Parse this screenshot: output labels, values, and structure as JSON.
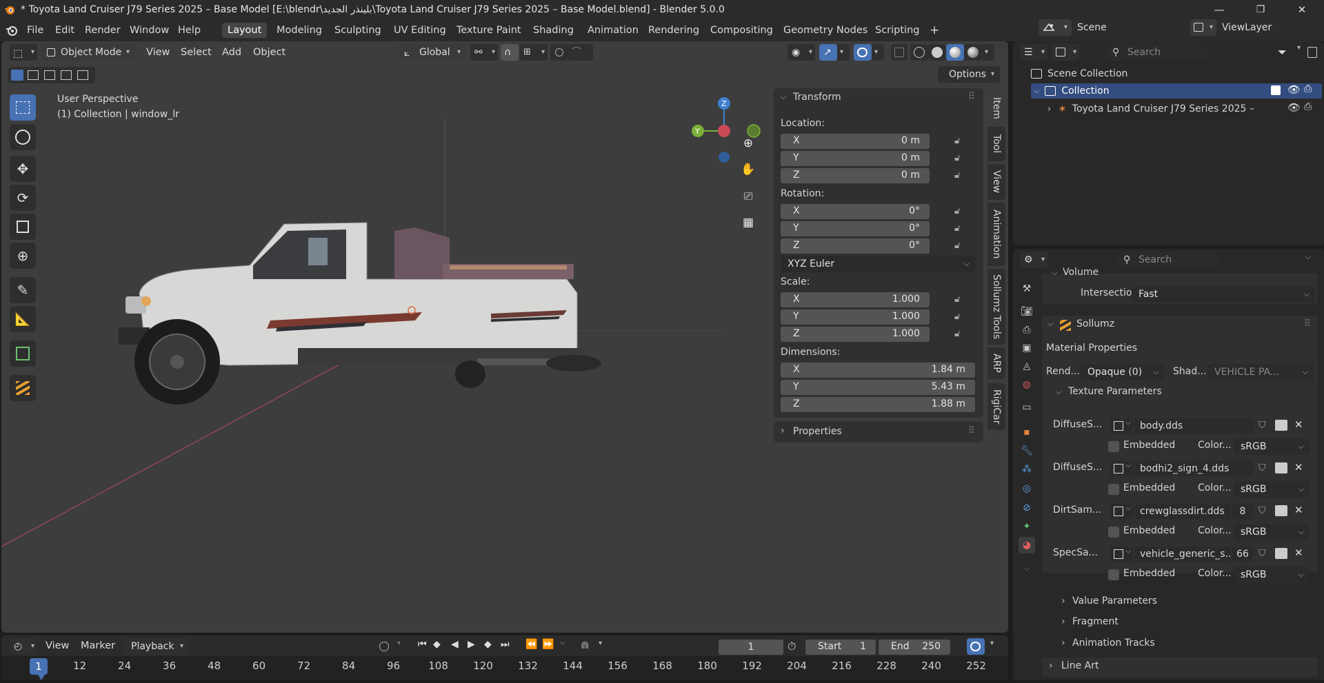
{
  "window": {
    "title": "* Toyota Land Cruiser J79 Series 2025 – Base Model [E:\\blendr\\بلينذر الجديد\\Toyota Land Cruiser J79 Series 2025 – Base Model.blend] - Blender 5.0.0",
    "minimize": "—",
    "maximize": "❐",
    "close": "✕"
  },
  "menu": {
    "items": [
      "File",
      "Edit",
      "Render",
      "Window",
      "Help"
    ],
    "workspaces": [
      "Layout",
      "Modeling",
      "Sculpting",
      "UV Editing",
      "Texture Paint",
      "Shading",
      "Animation",
      "Rendering",
      "Compositing",
      "Geometry Nodes",
      "Scripting"
    ],
    "active_workspace": "Layout",
    "add_tab": "+",
    "scene": "Scene",
    "view_layer": "ViewLayer"
  },
  "viewport_header": {
    "mode": "Object Mode",
    "menus": [
      "View",
      "Select",
      "Add",
      "Object"
    ],
    "orientation": "Global",
    "options": "Options"
  },
  "viewport": {
    "perspective_line1": "User Perspective",
    "perspective_line2": "(1) Collection | window_lr",
    "gizmo": {
      "x": "X",
      "y": "Y",
      "z": "Z"
    },
    "colors": {
      "background": "#3d3d3d",
      "x_axis": "#c94a55",
      "y_axis": "#7ab03a",
      "z_axis": "#3f7fd0",
      "accent": "#4772b3"
    }
  },
  "npanel": {
    "tabs": [
      "Item",
      "Tool",
      "View",
      "Animation",
      "Sollumz Tools",
      "ARP",
      "RigiCar"
    ],
    "active_tab": "Item",
    "transform_title": "Transform",
    "location_label": "Location:",
    "location": [
      {
        "k": "X",
        "v": "0 m"
      },
      {
        "k": "Y",
        "v": "0 m"
      },
      {
        "k": "Z",
        "v": "0 m"
      }
    ],
    "rotation_label": "Rotation:",
    "rotation": [
      {
        "k": "X",
        "v": "0°"
      },
      {
        "k": "Y",
        "v": "0°"
      },
      {
        "k": "Z",
        "v": "0°"
      }
    ],
    "rotation_mode": "XYZ Euler",
    "scale_label": "Scale:",
    "scale": [
      {
        "k": "X",
        "v": "1.000"
      },
      {
        "k": "Y",
        "v": "1.000"
      },
      {
        "k": "Z",
        "v": "1.000"
      }
    ],
    "dimensions_label": "Dimensions:",
    "dimensions": [
      {
        "k": "X",
        "v": "1.84 m"
      },
      {
        "k": "Y",
        "v": "5.43 m"
      },
      {
        "k": "Z",
        "v": "1.88 m"
      }
    ],
    "properties_title": "Properties"
  },
  "outliner": {
    "search_placeholder": "Search",
    "scene_collection": "Scene Collection",
    "collection": "Collection",
    "object": "Toyota Land Cruiser J79 Series 2025 –"
  },
  "properties": {
    "search_placeholder": "Search",
    "volume_label": "Volume",
    "intersection_label": "Intersection",
    "intersection_value": "Fast",
    "sollumz_title": "Sollumz",
    "material_properties": "Material Properties",
    "render_label": "Rend...",
    "render_value": "Opaque (0)",
    "shader_label": "Shad...",
    "shader_value": "VEHICLE PA...",
    "texture_params_title": "Texture Parameters",
    "textures": [
      {
        "label": "DiffuseS...",
        "file": "body.dds",
        "count": "",
        "embedded": "Embedded",
        "color_label": "Color...",
        "color": "sRGB"
      },
      {
        "label": "DiffuseS...",
        "file": "bodhi2_sign_4.dds",
        "count": "",
        "embedded": "Embedded",
        "color_label": "Color...",
        "color": "sRGB"
      },
      {
        "label": "DirtSam...",
        "file": "crewglassdirt.dds",
        "count": "8",
        "embedded": "Embedded",
        "color_label": "Color...",
        "color": "sRGB"
      },
      {
        "label": "SpecSa...",
        "file": "vehicle_generic_s...",
        "count": "66",
        "embedded": "Embedded",
        "color_label": "Color...",
        "color": "sRGB"
      }
    ],
    "value_params": "Value Parameters",
    "fragment": "Fragment",
    "animation_tracks": "Animation Tracks",
    "line_art": "Line Art"
  },
  "timeline": {
    "menus": [
      "View",
      "Marker"
    ],
    "playback": "Playback",
    "current_frame": "1",
    "start_label": "Start",
    "start": "1",
    "end_label": "End",
    "end": "250",
    "ticks": [
      "12",
      "24",
      "36",
      "48",
      "60",
      "72",
      "84",
      "96",
      "108",
      "120",
      "132",
      "144",
      "156",
      "168",
      "180",
      "192",
      "204",
      "216",
      "228",
      "240",
      "252"
    ],
    "playhead": "1"
  }
}
